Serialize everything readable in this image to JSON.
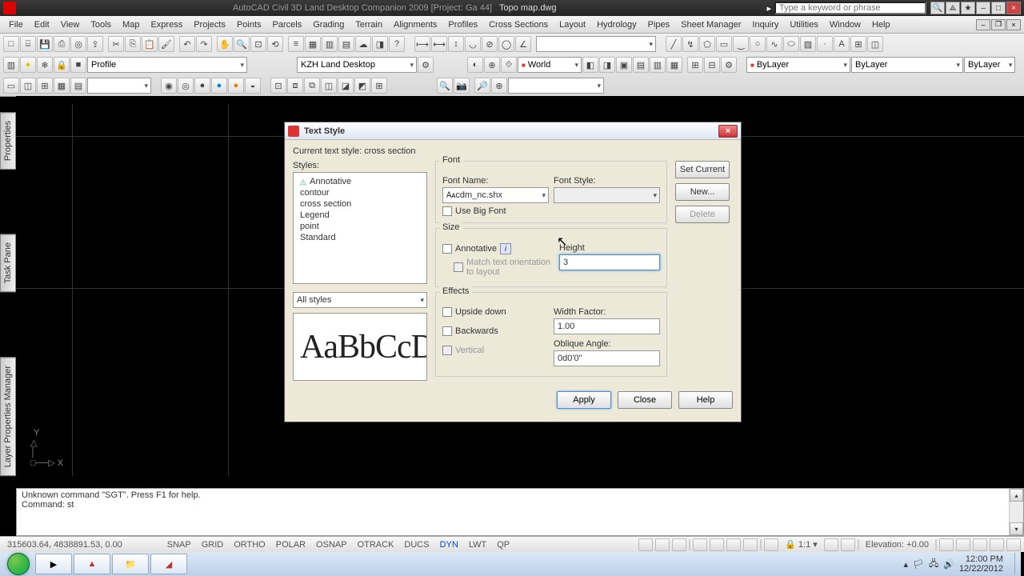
{
  "titlebar": {
    "app_title": "AutoCAD Civil 3D Land Desktop Companion 2009 [Project: Ga 44]",
    "doc_title": "Topo map.dwg",
    "search_placeholder": "Type a keyword or phrase"
  },
  "menu": {
    "items": [
      "File",
      "Edit",
      "View",
      "Tools",
      "Map",
      "Express",
      "Projects",
      "Points",
      "Parcels",
      "Grading",
      "Terrain",
      "Alignments",
      "Profiles",
      "Cross Sections",
      "Layout",
      "Hydrology",
      "Pipes",
      "Sheet Manager",
      "Inquiry",
      "Utilities",
      "Window",
      "Help"
    ]
  },
  "toolbar": {
    "profile_dd": "Profile",
    "workspace_dd": "KZH Land Desktop",
    "world_dd": "World",
    "layer_dd": "ByLayer",
    "linetype_dd": "ByLayer",
    "lineweight_dd": "ByLayer"
  },
  "side_tabs": [
    "Properties",
    "Task Pane",
    "Layer Properties Manager"
  ],
  "dialog": {
    "title": "Text Style",
    "current_label": "Current text style:  cross section",
    "styles_label": "Styles:",
    "styles": [
      "Annotative",
      "contour",
      "cross section",
      "Legend",
      "point",
      "Standard"
    ],
    "filter": "All styles",
    "preview": "AaBbCcD",
    "font_group": "Font",
    "font_name_label": "Font Name:",
    "font_name_value": "cdm_nc.shx",
    "font_style_label": "Font Style:",
    "font_style_value": "",
    "use_big_font": "Use Big Font",
    "size_group": "Size",
    "annotative_label": "Annotative",
    "match_orient": "Match text orientation to layout",
    "height_label": "Height",
    "height_value": "3",
    "effects_group": "Effects",
    "upside_down": "Upside down",
    "backwards": "Backwards",
    "vertical": "Vertical",
    "width_label": "Width Factor:",
    "width_value": "1.00",
    "oblique_label": "Oblique Angle:",
    "oblique_value": "0d0'0\"",
    "btn_set_current": "Set Current",
    "btn_new": "New...",
    "btn_delete": "Delete",
    "btn_apply": "Apply",
    "btn_close": "Close",
    "btn_help": "Help"
  },
  "cmd": {
    "line1": "Unknown command \"SGT\".  Press F1 for help.",
    "line2": "Command: st"
  },
  "status": {
    "coords": "315603.64, 4838891.53, 0.00",
    "toggles": [
      "SNAP",
      "GRID",
      "ORTHO",
      "POLAR",
      "OSNAP",
      "OTRACK",
      "DUCS",
      "DYN",
      "LWT",
      "QP"
    ],
    "scale": "1:1",
    "elevation": "Elevation: +0.00"
  },
  "tray": {
    "time": "12:00 PM",
    "date": "12/22/2012"
  },
  "ucs": {
    "y": "Y",
    "x": "X"
  }
}
